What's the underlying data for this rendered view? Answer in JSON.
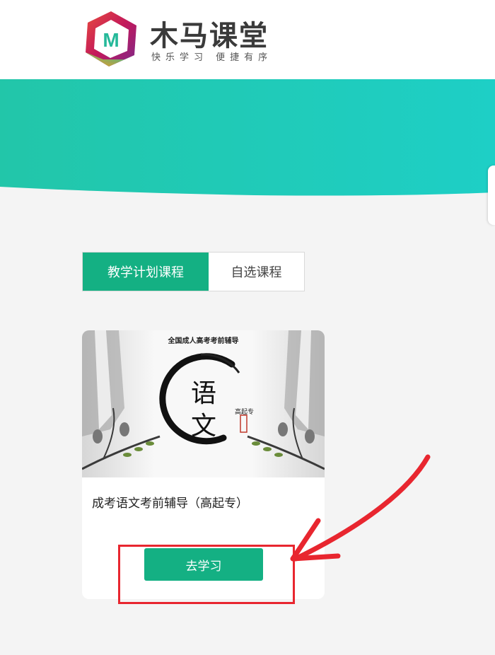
{
  "brand": {
    "name": "木马课堂",
    "slogan": "快乐学习 便捷有序",
    "logo_letter": "M"
  },
  "tabs": [
    {
      "label": "教学计划课程",
      "active": true
    },
    {
      "label": "自选课程",
      "active": false
    }
  ],
  "course": {
    "cover_subtitle": "全国成人高考考前辅导",
    "cover_char_1": "语",
    "cover_char_2": "文",
    "cover_tag": "高起专",
    "title": "成考语文考前辅导（高起专）",
    "button_label": "去学习"
  },
  "colors": {
    "accent": "#14b083",
    "banner_start": "#22c6a9",
    "banner_end": "#1ecfc6",
    "annotation": "#e8262f"
  },
  "icons": {
    "logo": "hexagon-logo-icon",
    "annotation": "red-arrow-annotation"
  }
}
